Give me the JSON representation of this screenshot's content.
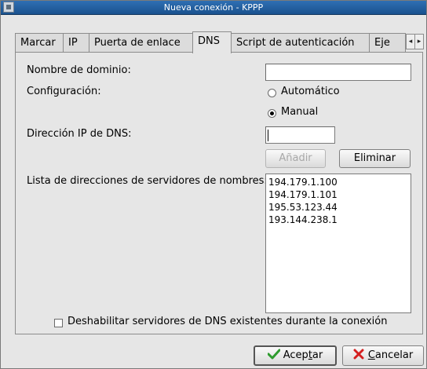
{
  "window": {
    "title": "Nueva conexión - KPPP"
  },
  "tabs": [
    {
      "label": "Marcar"
    },
    {
      "label": "IP"
    },
    {
      "label": "Puerta de enlace"
    },
    {
      "label": "DNS",
      "active": true
    },
    {
      "label": "Script de autenticación"
    },
    {
      "label": "Eje"
    }
  ],
  "dns": {
    "domain_label": "Nombre de dominio:",
    "domain_value": "",
    "config_label": "Configuración:",
    "radio_auto": "Automático",
    "radio_manual": "Manual",
    "selected": "Manual",
    "ip_label": "Dirección IP de DNS:",
    "ip_value": "",
    "add_button": "Añadir",
    "remove_button": "Eliminar",
    "list_label": "Lista de direcciones de servidores de nombres:",
    "servers": [
      "194.179.1.100",
      "194.179.1.101",
      "195.53.123.44",
      "193.144.238.1"
    ],
    "disable_checkbox": "Deshabilitar servidores de DNS existentes durante la conexión",
    "disable_checked": false
  },
  "footer": {
    "ok_prefix": "Acep",
    "ok_mnemonic": "t",
    "ok_suffix": "ar",
    "cancel_mnemonic": "C",
    "cancel_suffix": "ancelar"
  },
  "icons": {
    "window": "app-icon",
    "ok": "checkmark-icon",
    "cancel": "cross-icon",
    "tab_scroll_left": "chevron-left-icon",
    "tab_scroll_right": "chevron-right-icon"
  },
  "colors": {
    "titlebar": "#1f5ea0",
    "ok_check": "#2e9b2e",
    "cancel_x": "#d42020"
  }
}
